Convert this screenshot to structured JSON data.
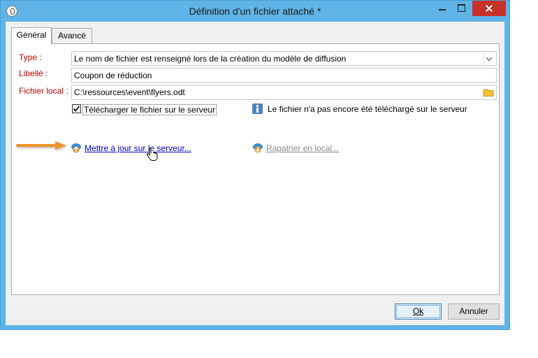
{
  "window": {
    "title": "Définition d'un fichier attaché *"
  },
  "tabs": [
    {
      "label": "Général"
    },
    {
      "label": "Avancé"
    }
  ],
  "form": {
    "type_label": "Type :",
    "type_value": "Le nom de fichier est renseigné lors de la création du modèle de diffusion",
    "libelle_label": "Libellé :",
    "libelle_value": "Coupon de réduction",
    "local_file_label": "Fichier local :",
    "local_file_value": "C:\\ressources\\event\\flyers.odt",
    "upload_checkbox_label": "Télécharger le fichier sur le serveur",
    "upload_checked": true,
    "info_text": "Le fichier n'a pas encore été téléchargé sur le serveur",
    "update_link": "Mettre à jour sur le serveur...",
    "repatriate_link": "Rapatrier en local..."
  },
  "buttons": {
    "ok": "Ok",
    "cancel": "Annuler"
  },
  "colors": {
    "titlebar": "#5fb3e6",
    "label_red": "#c00000",
    "link_blue": "#0000cc",
    "arrow_orange": "#f0922b"
  }
}
